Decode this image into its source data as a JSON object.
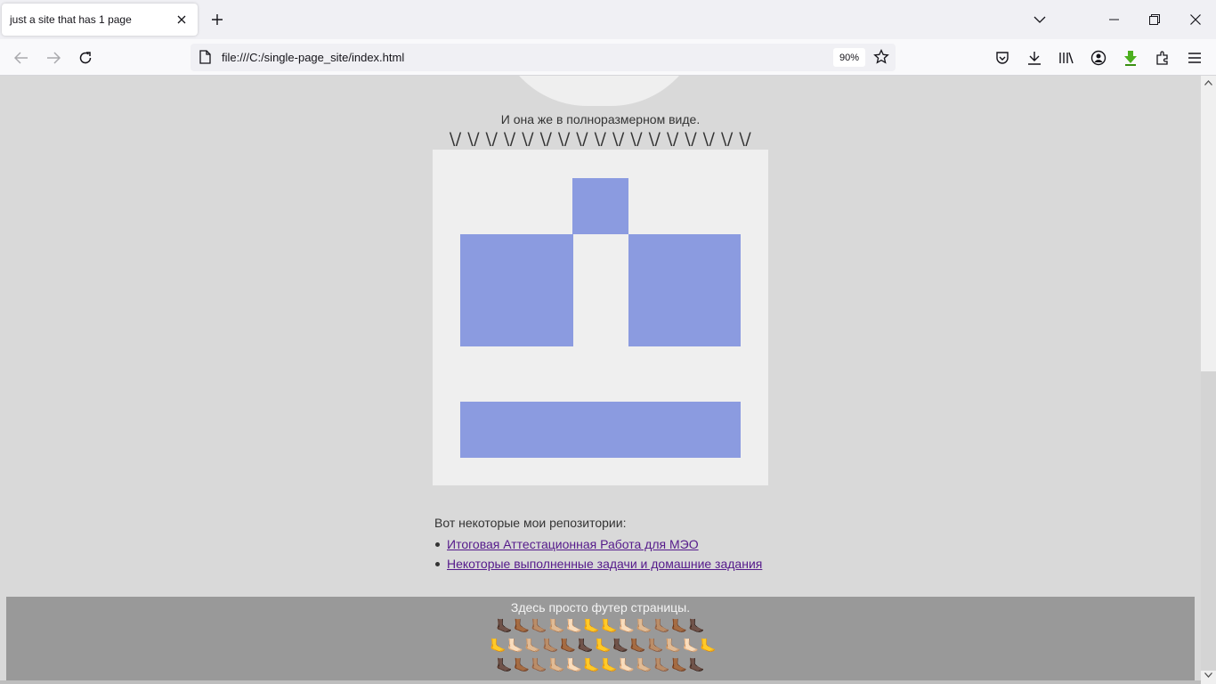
{
  "browser": {
    "tab_title": "just a site that has 1 page",
    "url": "file:///C:/single-page_site/index.html",
    "zoom": "90%"
  },
  "page": {
    "caption": "И она же в полноразмерном виде.",
    "zigzag": "\\/ \\/ \\/ \\/ \\/ \\/ \\/ \\/ \\/ \\/ \\/ \\/ \\/ \\/ \\/ \\/ \\/",
    "repos_title": "Вот некоторые мои репозитории:",
    "repos": [
      {
        "label": "Итоговая Аттестационная Работа для МЭО"
      },
      {
        "label": "Некоторые выполненные задачи и домашние задания"
      }
    ],
    "footer_text": "Здесь просто футер страницы.",
    "feet_rows": [
      "🦶🏿🦶🏾🦶🏽🦶🏼🦶🏻🦶🦶🦶🏻🦶🏼🦶🏽🦶🏾🦶🏿",
      "🦶🦶🏻🦶🏼🦶🏽🦶🏾🦶🏿🦶🦶🏿🦶🏾🦶🏽🦶🏼🦶🏻🦶",
      "🦶🏿🦶🏾🦶🏽🦶🏼🦶🏻🦶🦶🦶🏻🦶🏼🦶🏽🦶🏾🦶🏿"
    ]
  },
  "colors": {
    "accent_blue": "#8b9be0",
    "footer_bg": "#999999",
    "link": "#551a8b"
  }
}
